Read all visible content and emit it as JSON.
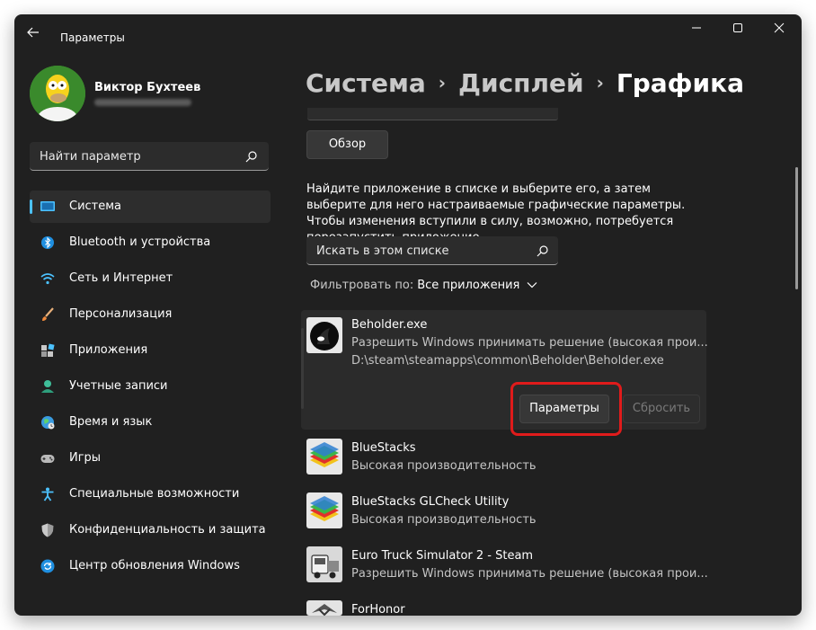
{
  "window": {
    "title": "Параметры",
    "controls": {
      "minimize": "—",
      "maximize": "☐",
      "close": "✕"
    }
  },
  "user": {
    "name": "Виктор Бухтеев"
  },
  "sidebar": {
    "search_placeholder": "Найти параметр",
    "items": [
      {
        "label": "Система",
        "icon": "display-icon",
        "active": true
      },
      {
        "label": "Bluetooth и устройства",
        "icon": "bluetooth-icon"
      },
      {
        "label": "Сеть и Интернет",
        "icon": "wifi-icon"
      },
      {
        "label": "Персонализация",
        "icon": "brush-icon"
      },
      {
        "label": "Приложения",
        "icon": "apps-icon"
      },
      {
        "label": "Учетные записи",
        "icon": "person-icon"
      },
      {
        "label": "Время и язык",
        "icon": "globe-icon"
      },
      {
        "label": "Игры",
        "icon": "gamepad-icon"
      },
      {
        "label": "Специальные возможности",
        "icon": "accessibility-icon"
      },
      {
        "label": "Конфиденциальность и защита",
        "icon": "shield-icon"
      },
      {
        "label": "Центр обновления Windows",
        "icon": "update-icon"
      }
    ]
  },
  "breadcrumb": {
    "part1": "Система",
    "part2": "Дисплей",
    "current": "Графика",
    "separator": "›"
  },
  "main": {
    "browse_label": "Обзор",
    "description": "Найдите приложение в списке и выберите его, а затем выберите для него настраиваемые графические параметры. Чтобы изменения вступили в силу, возможно, потребуется перезапустить приложение.",
    "list_search_placeholder": "Искать в этом списке",
    "filter_label": "Фильтровать по:",
    "filter_value": "Все приложения",
    "apps": [
      {
        "name": "Beholder.exe",
        "sub": "Разрешить Windows принимать решение (высокая прои...",
        "path": "D:\\steam\\steamapps\\common\\Beholder\\Beholder.exe"
      },
      {
        "name": "BlueStacks",
        "sub": "Высокая производительность"
      },
      {
        "name": "BlueStacks GLCheck Utility",
        "sub": "Высокая производительность"
      },
      {
        "name": "Euro Truck Simulator 2 - Steam",
        "sub": "Разрешить Windows принимать решение (высокая прои..."
      },
      {
        "name": "ForHonor",
        "sub": ""
      }
    ],
    "params_label": "Параметры",
    "reset_label": "Сбросить"
  },
  "colors": {
    "accent": "#4cc2ff",
    "highlight": "#e01b1b",
    "background": "#202020"
  }
}
